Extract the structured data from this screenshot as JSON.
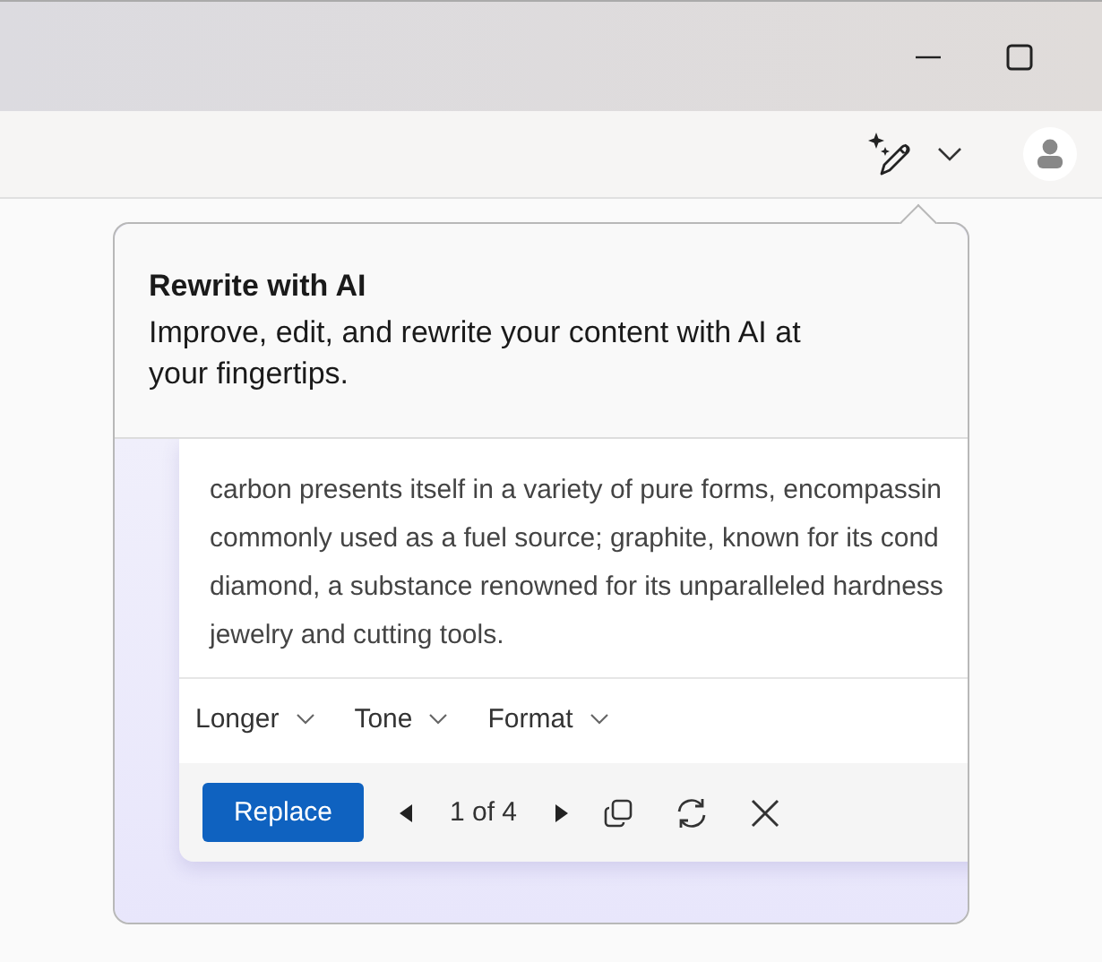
{
  "window": {
    "controls": [
      {
        "kind": "minimize"
      },
      {
        "kind": "maximize"
      }
    ]
  },
  "toolbar": {
    "buttons": [
      {
        "kind": "rewrite"
      },
      {
        "kind": "chevron"
      },
      {
        "kind": "avatar"
      }
    ]
  },
  "callout": {
    "title": "Rewrite with AI",
    "description": "Improve, edit, and rewrite your content with AI at your fingertips.",
    "preview": {
      "lines": [
        "carbon presents itself in a variety of pure forms, encompassin",
        "commonly used as a fuel source; graphite, known for its cond",
        "diamond, a substance renowned for its unparalleled hardness",
        "jewelry and cutting tools."
      ],
      "options": [
        "Longer",
        "Tone",
        "Format"
      ],
      "replace": "Replace",
      "counter": "1 of 4",
      "actions": [
        {
          "kind": "copy"
        },
        {
          "kind": "regenerate"
        },
        {
          "kind": "close"
        }
      ]
    }
  }
}
